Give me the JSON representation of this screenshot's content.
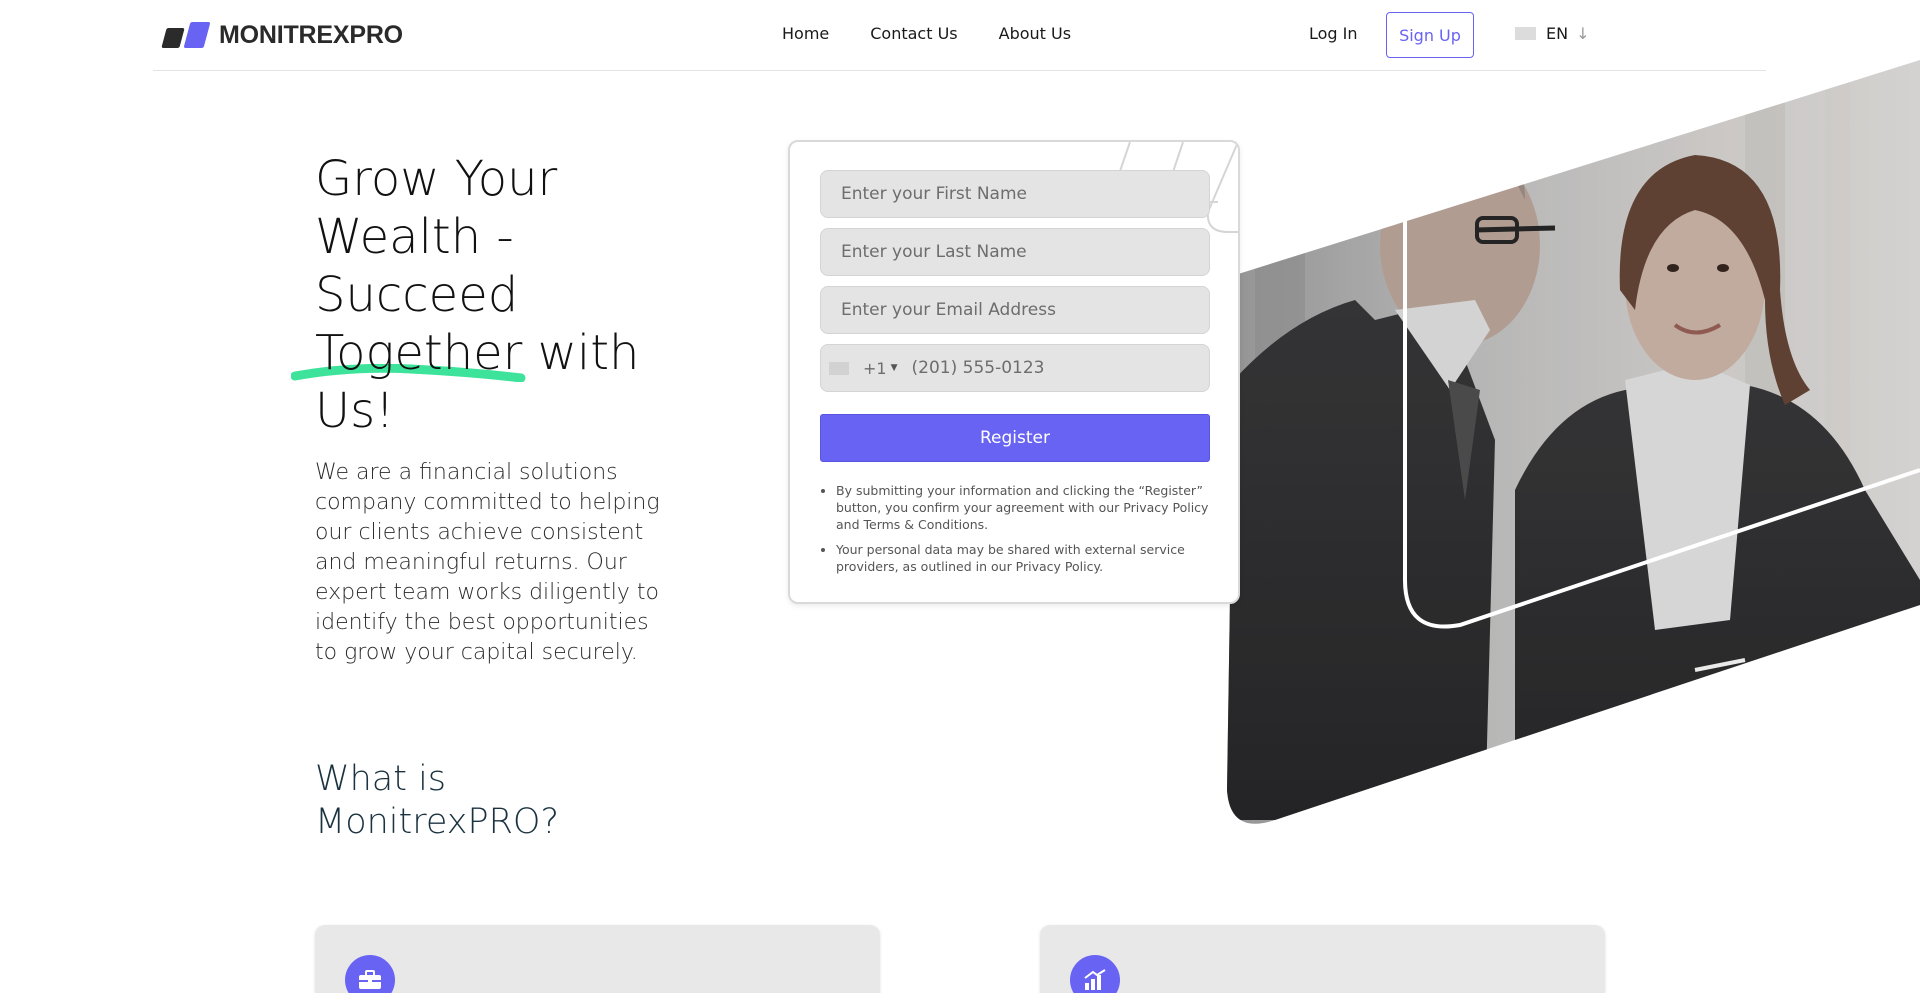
{
  "header": {
    "brand": "MONITREXPRO",
    "nav": [
      {
        "label": "Home"
      },
      {
        "label": "Contact Us"
      },
      {
        "label": "About Us"
      }
    ],
    "login_label": "Log In",
    "signup_label": "Sign Up",
    "language": "EN"
  },
  "hero": {
    "title_before": "Grow Your Wealth - Succeed ",
    "title_highlight": "Together",
    "title_after": " with Us!",
    "description": "We are a financial solutions company committed to helping our clients achieve consistent and meaningful returns. Our expert team works diligently to identify the best opportunities to grow your capital securely."
  },
  "form": {
    "first_name_placeholder": "Enter your First Name",
    "last_name_placeholder": "Enter your Last Name",
    "email_placeholder": "Enter your Email Address",
    "phone_code": "+1",
    "phone_placeholder": "(201) 555-0123",
    "register_label": "Register",
    "notes": [
      "By submitting your information and clicking the “Register” button, you confirm your agreement with our Privacy Policy and Terms & Conditions.",
      "Your personal data may be shared with external service providers, as outlined in our Privacy Policy."
    ]
  },
  "section": {
    "title": "What is MonitrexPRO?"
  },
  "icons": {
    "feature_1": "briefcase-icon",
    "feature_2": "growth-chart-icon"
  },
  "colors": {
    "accent": "#6863f3",
    "highlight": "#3de39b",
    "heading_dark": "#1b3340"
  }
}
